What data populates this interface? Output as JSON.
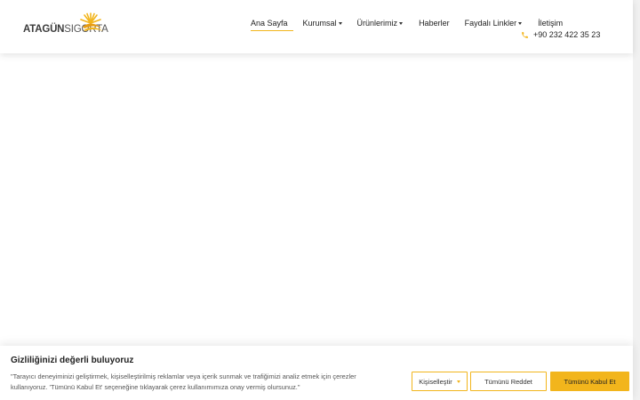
{
  "header": {
    "logo": {
      "bold": "ATAGÜN",
      "thin": "SIGORTA"
    },
    "nav": [
      {
        "label": "Ana Sayfa",
        "has_dropdown": false,
        "active": true
      },
      {
        "label": "Kurumsal",
        "has_dropdown": true,
        "active": false
      },
      {
        "label": "Ürünlerimiz",
        "has_dropdown": true,
        "active": false
      },
      {
        "label": "Haberler",
        "has_dropdown": false,
        "active": false
      },
      {
        "label": "Faydalı Linkler",
        "has_dropdown": true,
        "active": false
      },
      {
        "label": "İletişim",
        "has_dropdown": false,
        "active": false
      }
    ],
    "phone": {
      "icon": "phone-icon",
      "number": "+90 232 422 35 23"
    }
  },
  "cookie_banner": {
    "title": "Gizliliğinizi değerli buluyoruz",
    "text": "\"Tarayıcı deneyiminizi geliştirmek, kişiselleştirilmiş reklamlar veya içerik sunmak ve trafiğimizi analiz etmek için çerezler kullanıyoruz. 'Tümünü Kabul Et' seçeneğine tıklayarak çerez kullanımımıza onay vermiş olursunuz.\"",
    "customize_label": "Kişiselleştir",
    "reject_label": "Tümünü Reddet",
    "accept_label": "Tümünü Kabul Et"
  },
  "colors": {
    "accent": "#f2b51c",
    "text": "#222222"
  }
}
